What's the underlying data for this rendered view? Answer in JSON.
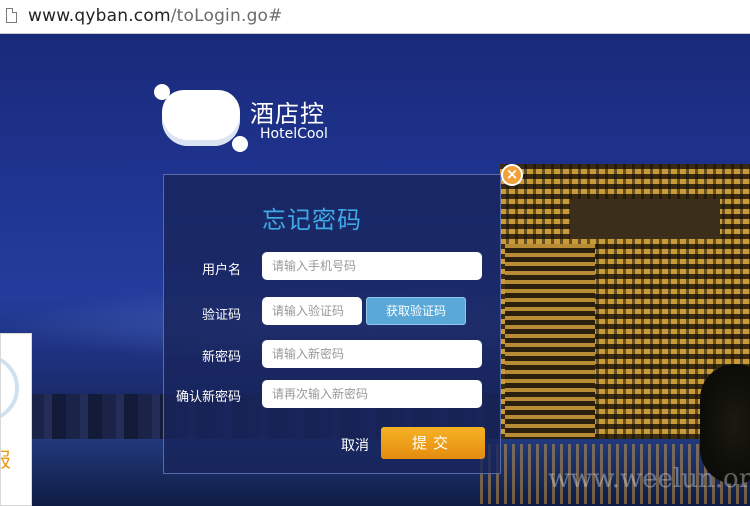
{
  "browser": {
    "url_host": "www.qyban.com",
    "url_path": "/toLogin.go#"
  },
  "logo": {
    "name_cn": "酒店控",
    "name_en": "HotelCool"
  },
  "dialog": {
    "title": "忘记密码",
    "close_glyph": "×",
    "fields": {
      "username": {
        "label": "用户名",
        "placeholder": "请输入手机号码"
      },
      "code": {
        "label": "验证码",
        "placeholder": "请输入验证码",
        "button": "获取验证码"
      },
      "new_password": {
        "label": "新密码",
        "placeholder": "请输入新密码"
      },
      "confirm_password": {
        "label": "确认新密码",
        "placeholder": "请再次输入新密码"
      }
    },
    "cancel_label": "取消",
    "submit_label": "提交"
  },
  "side_card": {
    "char": "报"
  },
  "watermark": "www.weelun.org",
  "colors": {
    "title": "#3fa9e8",
    "submit": "#f0a01c",
    "code_button": "#5aa8d8",
    "close": "#f2a13a"
  }
}
